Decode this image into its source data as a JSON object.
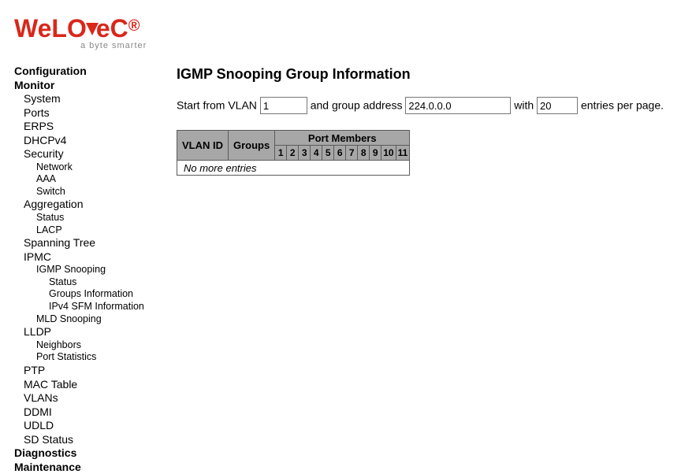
{
  "logo": {
    "main_text": "WeLOTeC",
    "sub_text": "a byte smarter"
  },
  "nav": {
    "configuration": "Configuration",
    "monitor": "Monitor",
    "system": "System",
    "ports": "Ports",
    "erps": "ERPS",
    "dhcpv4": "DHCPv4",
    "security": "Security",
    "sec_network": "Network",
    "sec_aaa": "AAA",
    "sec_switch": "Switch",
    "aggregation": "Aggregation",
    "agg_status": "Status",
    "agg_lacp": "LACP",
    "spanning_tree": "Spanning Tree",
    "ipmc": "IPMC",
    "igmp_snooping": "IGMP Snooping",
    "igmp_status": "Status",
    "igmp_groups": "Groups Information",
    "igmp_sfm": "IPv4 SFM Information",
    "mld_snooping": "MLD Snooping",
    "lldp": "LLDP",
    "lldp_neighbors": "Neighbors",
    "lldp_port_stats": "Port Statistics",
    "ptp": "PTP",
    "mac_table": "MAC Table",
    "vlans": "VLANs",
    "ddmi": "DDMI",
    "udld": "UDLD",
    "sd_status": "SD Status",
    "diagnostics": "Diagnostics",
    "maintenance": "Maintenance"
  },
  "page": {
    "title": "IGMP Snooping Group Information",
    "filter": {
      "start_from_vlan_label": "Start from VLAN",
      "vlan_value": "1",
      "group_label": "and group address",
      "group_value": "224.0.0.0",
      "with_label": "with",
      "entries_value": "20",
      "entries_label": "entries per page."
    },
    "table": {
      "port_members_header": "Port Members",
      "vlan_id_header": "VLAN ID",
      "groups_header": "Groups",
      "ports": [
        "1",
        "2",
        "3",
        "4",
        "5",
        "6",
        "7",
        "8",
        "9",
        "10",
        "11"
      ],
      "no_more": "No more entries"
    }
  }
}
